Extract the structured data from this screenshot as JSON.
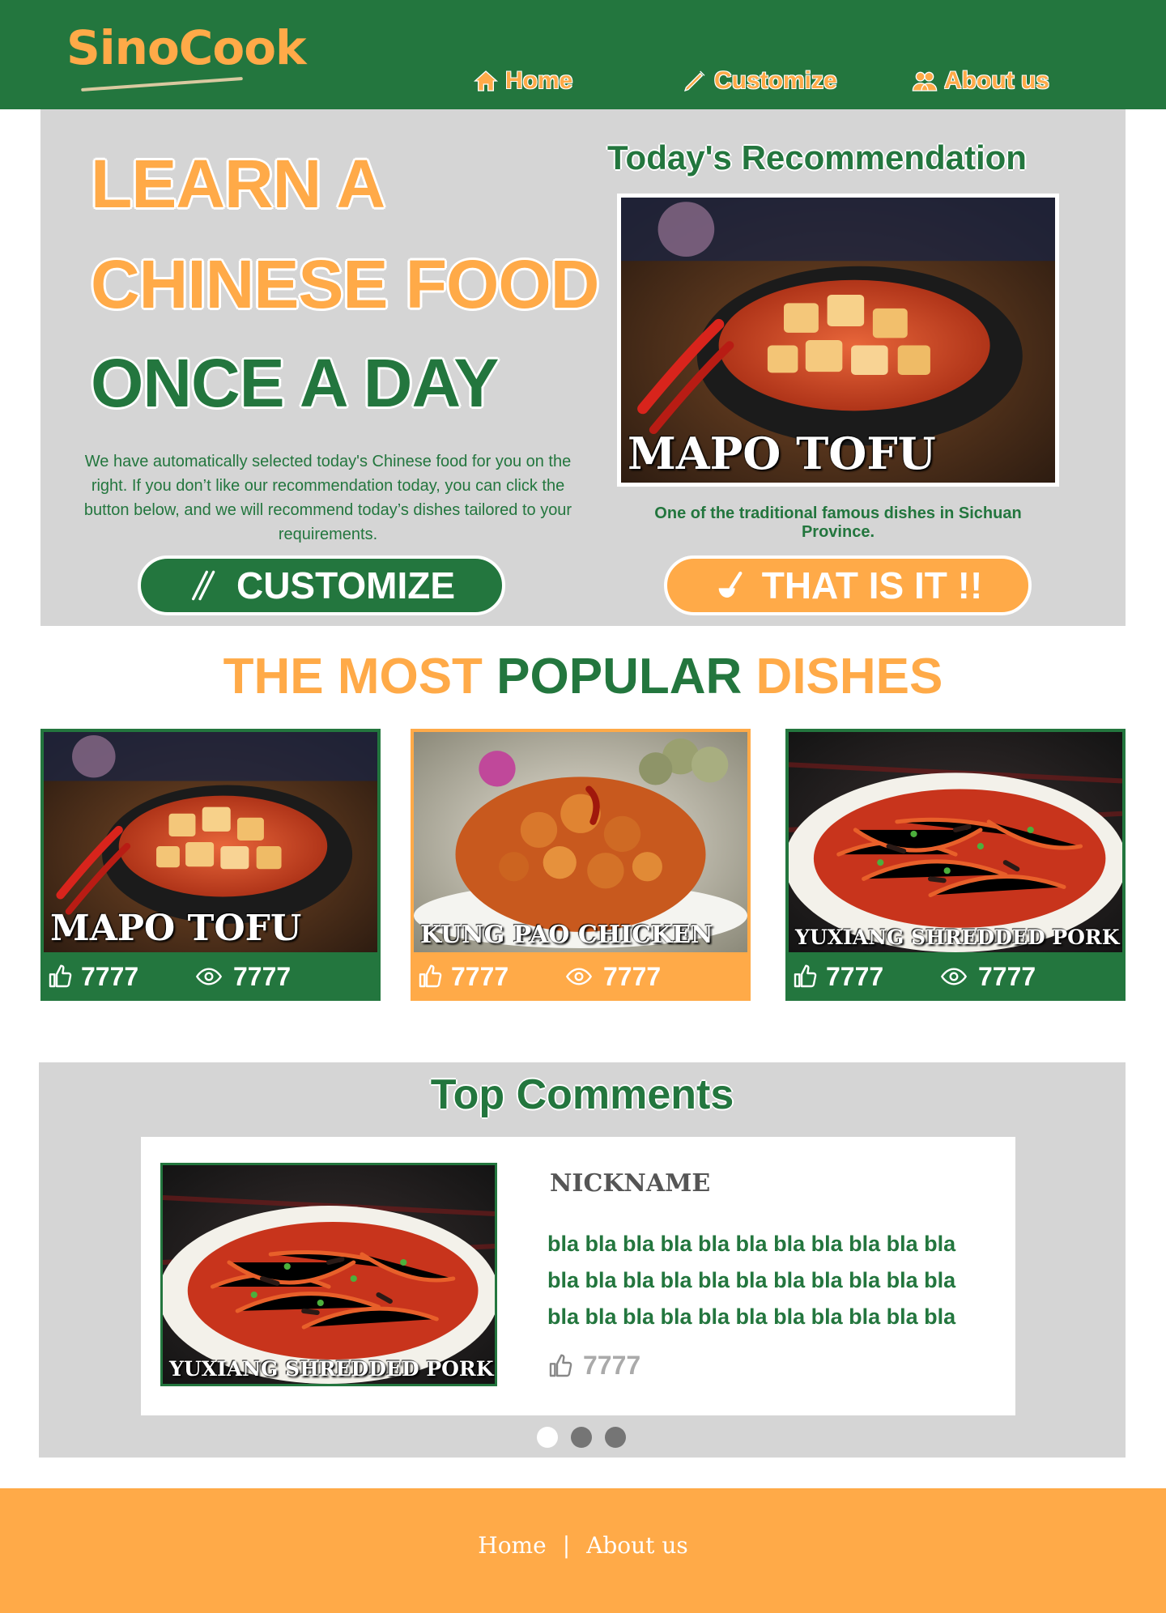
{
  "brand": {
    "logo_text": "SinoCook",
    "colors": {
      "green": "#23763e",
      "orange": "#ffaa48",
      "gray_panel": "#d5d5d5"
    }
  },
  "nav": {
    "home": {
      "label": "Home",
      "icon": "home-icon"
    },
    "customize": {
      "label": "Customize",
      "icon": "pencil-icon"
    },
    "about": {
      "label": "About us",
      "icon": "users-icon"
    }
  },
  "hero": {
    "headline_1": "LEARN A",
    "headline_2": "CHINESE FOOD",
    "headline_3": "ONCE A DAY",
    "description": "We have automatically selected today's Chinese food for you on the right. If you don’t like our recommendation today, you can click the button below, and we will recommend today’s dishes tailored to your requirements.",
    "customize_button": "CUSTOMIZE",
    "thatis_button": "THAT IS IT !!",
    "recommendation_title": "Today's Recommendation",
    "recommendation_dish": "MAPO TOFU",
    "recommendation_caption": "One of the traditional famous dishes in Sichuan Province."
  },
  "popular": {
    "title_part1": "THE MOST ",
    "title_part2": "POPULAR",
    "title_part3": " DISHES",
    "cards": [
      {
        "name": "MAPO TOFU",
        "likes": "7777",
        "views": "7777",
        "theme": "#23763e"
      },
      {
        "name": "KUNG PAO CHICKEN",
        "likes": "7777",
        "views": "7777",
        "theme": "#ffaa48"
      },
      {
        "name": "YUXIANG SHREDDED PORK",
        "likes": "7777",
        "views": "7777",
        "theme": "#23763e"
      }
    ]
  },
  "comments": {
    "title": "Top Comments",
    "dish": "YUXIANG SHREDDED PORK",
    "nickname": "NICKNAME",
    "text": "bla bla bla bla bla bla bla bla bla bla bla bla bla bla bla bla bla bla bla bla bla bla bla bla bla bla bla bla bla bla bla bla bla",
    "likes": "7777",
    "carousel_active_index": 0
  },
  "footer": {
    "home": "Home",
    "separator": "|",
    "about": "About us"
  }
}
